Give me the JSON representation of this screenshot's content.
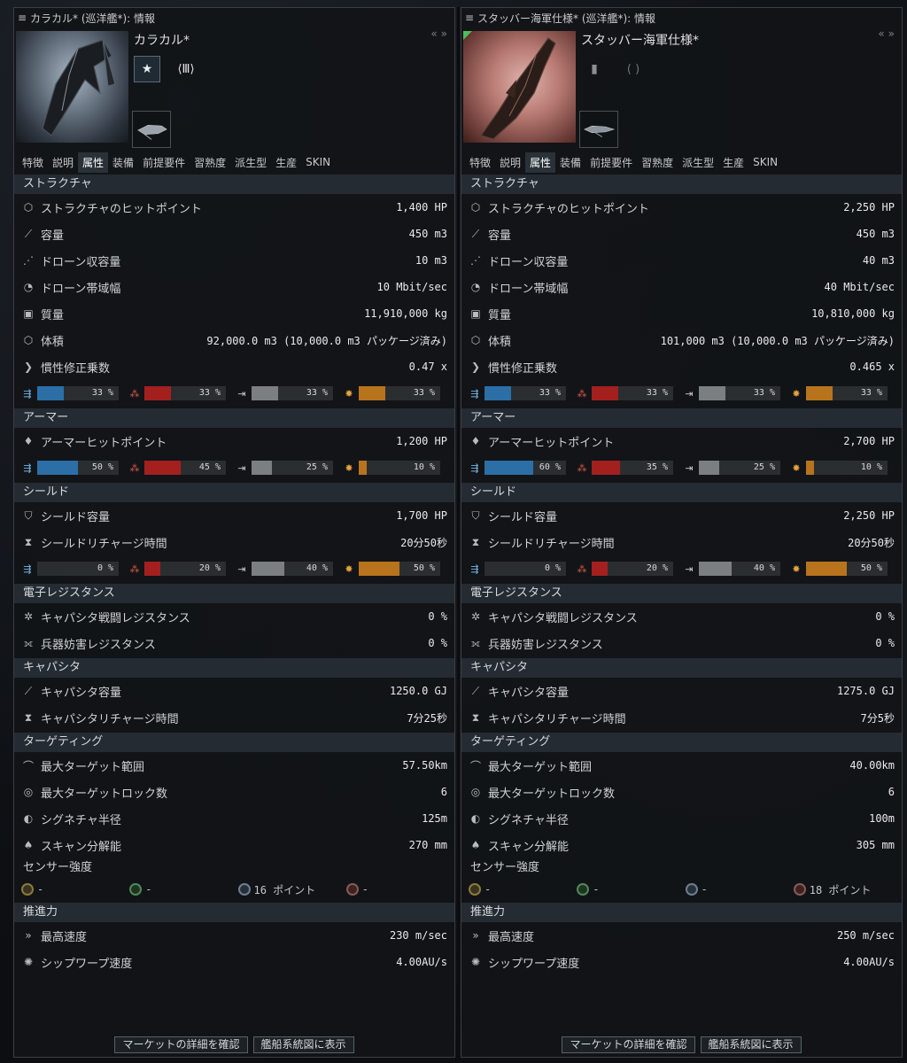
{
  "left": {
    "window_title": "カラカル* (巡洋艦*): 情報",
    "ship_name": "カラカル*",
    "tabs": [
      "特徴",
      "説明",
      "属性",
      "装備",
      "前提要件",
      "習熟度",
      "派生型",
      "生産",
      "SKIN"
    ],
    "active_tab": 2,
    "structure": {
      "title": "ストラクチャ",
      "hp_label": "ストラクチャのヒットポイント",
      "hp": "1,400 HP",
      "cargo_label": "容量",
      "cargo": "450 m3",
      "drone_bay_label": "ドローン収容量",
      "drone_bay": "10 m3",
      "drone_bw_label": "ドローン帯域幅",
      "drone_bw": "10 Mbit/sec",
      "mass_label": "質量",
      "mass": "11,910,000 kg",
      "volume_label": "体積",
      "volume": "92,000.0 m3 (10,000.0 m3 パッケージ済み)",
      "inertia_label": "慣性修正乗数",
      "inertia": "0.47 x",
      "res": {
        "em": {
          "text": "33 %",
          "value": 33
        },
        "th": {
          "text": "33 %",
          "value": 33
        },
        "ki": {
          "text": "33 %",
          "value": 33
        },
        "ex": {
          "text": "33 %",
          "value": 33
        }
      }
    },
    "armor": {
      "title": "アーマー",
      "hp_label": "アーマーヒットポイント",
      "hp": "1,200 HP",
      "res": {
        "em": {
          "text": "50 %",
          "value": 50
        },
        "th": {
          "text": "45 %",
          "value": 45
        },
        "ki": {
          "text": "25 %",
          "value": 25
        },
        "ex": {
          "text": "10 %",
          "value": 10
        }
      }
    },
    "shield": {
      "title": "シールド",
      "cap_label": "シールド容量",
      "cap": "1,700 HP",
      "recharge_label": "シールドリチャージ時間",
      "recharge": "20分50秒",
      "res": {
        "em": {
          "text": "0 %",
          "value": 0
        },
        "th": {
          "text": "20 %",
          "value": 20
        },
        "ki": {
          "text": "40 %",
          "value": 40
        },
        "ex": {
          "text": "50 %",
          "value": 50
        }
      }
    },
    "ew": {
      "title": "電子レジスタンス",
      "cap_warfare_label": "キャパシタ戦闘レジスタンス",
      "cap_warfare": "0 %",
      "weapon_disrupt_label": "兵器妨害レジスタンス",
      "weapon_disrupt": "0 %"
    },
    "capacitor": {
      "title": "キャパシタ",
      "cap_label": "キャパシタ容量",
      "cap": "1250.0 GJ",
      "recharge_label": "キャパシタリチャージ時間",
      "recharge": "7分25秒"
    },
    "targeting": {
      "title": "ターゲティング",
      "range_label": "最大ターゲット範囲",
      "range": "57.50km",
      "locks_label": "最大ターゲットロック数",
      "locks": "6",
      "sig_label": "シグネチャ半径",
      "sig": "125m",
      "scan_label": "スキャン分解能",
      "scan": "270 mm",
      "sensor_label": "センサー強度",
      "sensors": [
        "-",
        "-",
        "16 ポイント",
        "-"
      ]
    },
    "propulsion": {
      "title": "推進力",
      "speed_label": "最高速度",
      "speed": "230 m/sec",
      "warp_label": "シップワープ速度",
      "warp": "4.00AU/s"
    },
    "buttons": {
      "market": "マーケットの詳細を確認",
      "tree": "艦船系統図に表示"
    }
  },
  "right": {
    "window_title": "スタッバー海軍仕様* (巡洋艦*): 情報",
    "ship_name": "スタッバー海軍仕様*",
    "tabs": [
      "特徴",
      "説明",
      "属性",
      "装備",
      "前提要件",
      "習熟度",
      "派生型",
      "生産",
      "SKIN"
    ],
    "active_tab": 2,
    "structure": {
      "title": "ストラクチャ",
      "hp_label": "ストラクチャのヒットポイント",
      "hp": "2,250 HP",
      "cargo_label": "容量",
      "cargo": "450 m3",
      "drone_bay_label": "ドローン収容量",
      "drone_bay": "40 m3",
      "drone_bw_label": "ドローン帯域幅",
      "drone_bw": "40 Mbit/sec",
      "mass_label": "質量",
      "mass": "10,810,000 kg",
      "volume_label": "体積",
      "volume": "101,000 m3 (10,000.0 m3 パッケージ済み)",
      "inertia_label": "慣性修正乗数",
      "inertia": "0.465 x",
      "res": {
        "em": {
          "text": "33 %",
          "value": 33
        },
        "th": {
          "text": "33 %",
          "value": 33
        },
        "ki": {
          "text": "33 %",
          "value": 33
        },
        "ex": {
          "text": "33 %",
          "value": 33
        }
      }
    },
    "armor": {
      "title": "アーマー",
      "hp_label": "アーマーヒットポイント",
      "hp": "2,700 HP",
      "res": {
        "em": {
          "text": "60 %",
          "value": 60
        },
        "th": {
          "text": "35 %",
          "value": 35
        },
        "ki": {
          "text": "25 %",
          "value": 25
        },
        "ex": {
          "text": "10 %",
          "value": 10
        }
      }
    },
    "shield": {
      "title": "シールド",
      "cap_label": "シールド容量",
      "cap": "2,250 HP",
      "recharge_label": "シールドリチャージ時間",
      "recharge": "20分50秒",
      "res": {
        "em": {
          "text": "0 %",
          "value": 0
        },
        "th": {
          "text": "20 %",
          "value": 20
        },
        "ki": {
          "text": "40 %",
          "value": 40
        },
        "ex": {
          "text": "50 %",
          "value": 50
        }
      }
    },
    "ew": {
      "title": "電子レジスタンス",
      "cap_warfare_label": "キャパシタ戦闘レジスタンス",
      "cap_warfare": "0 %",
      "weapon_disrupt_label": "兵器妨害レジスタンス",
      "weapon_disrupt": "0 %"
    },
    "capacitor": {
      "title": "キャパシタ",
      "cap_label": "キャパシタ容量",
      "cap": "1275.0 GJ",
      "recharge_label": "キャパシタリチャージ時間",
      "recharge": "7分5秒"
    },
    "targeting": {
      "title": "ターゲティング",
      "range_label": "最大ターゲット範囲",
      "range": "40.00km",
      "locks_label": "最大ターゲットロック数",
      "locks": "6",
      "sig_label": "シグネチャ半径",
      "sig": "100m",
      "scan_label": "スキャン分解能",
      "scan": "305 mm",
      "sensor_label": "センサー強度",
      "sensors": [
        "-",
        "-",
        "-",
        "18 ポイント"
      ]
    },
    "propulsion": {
      "title": "推進力",
      "speed_label": "最高速度",
      "speed": "250 m/sec",
      "warp_label": "シップワープ速度",
      "warp": "4.00AU/s"
    },
    "buttons": {
      "market": "マーケットの詳細を確認",
      "tree": "艦船系統図に表示"
    }
  },
  "colors": {
    "em": "#2b6fa6",
    "thermal": "#a3201f",
    "kinetic": "#7c7f82",
    "explosive": "#b8741c",
    "section_bg": "#252b32"
  }
}
